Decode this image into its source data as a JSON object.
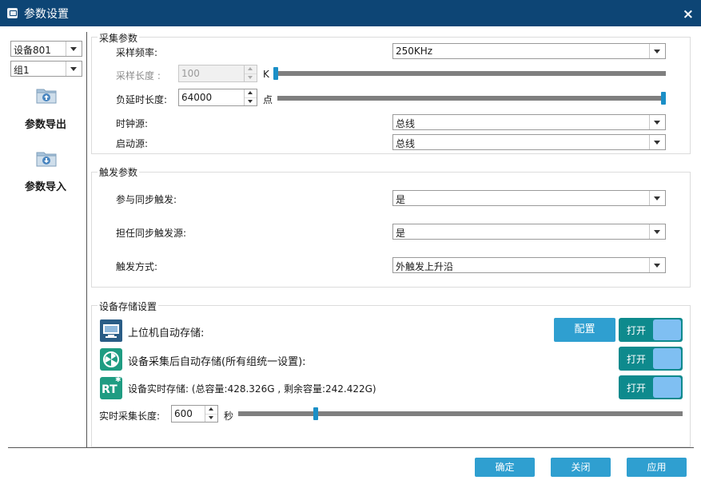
{
  "window": {
    "title": "参数设置",
    "close": "×"
  },
  "sidebar": {
    "device_select": "设备801",
    "group_select": "组1",
    "export_label": "参数导出",
    "import_label": "参数导入"
  },
  "acquisition": {
    "title": "采集参数",
    "sample_rate_label": "采样频率:",
    "sample_rate_value": "250KHz",
    "sample_length_label": "采样长度  :",
    "sample_length_value": "100",
    "sample_length_unit": "K",
    "sample_length_slider": 0.0,
    "neg_delay_label": "负延时长度:",
    "neg_delay_value": "64000",
    "neg_delay_unit": "点",
    "neg_delay_slider": 1.0,
    "clock_label": "时钟源:",
    "clock_value": "总线",
    "start_label": "启动源:",
    "start_value": "总线"
  },
  "trigger": {
    "title": "触发参数",
    "sync_label": "参与同步触发:",
    "sync_value": "是",
    "source_label": "担任同步触发源:",
    "source_value": "是",
    "mode_label": "触发方式:",
    "mode_value": "外触发上升沿"
  },
  "storage": {
    "title": "设备存储设置",
    "host_label": "上位机自动存储:",
    "config_button": "配置",
    "host_toggle": "打开",
    "after_label": "设备采集后自动存储(所有组统一设置):",
    "after_toggle": "打开",
    "realtime_label": "设备实时存储:  (总容量:428.326G , 剩余容量:242.422G)",
    "realtime_icon": "RT",
    "realtime_toggle": "打开",
    "length_label": "实时采集长度:",
    "length_value": "600",
    "length_unit": "秒",
    "length_slider": 0.17
  },
  "footer": {
    "ok": "确定",
    "close": "关闭",
    "apply": "应用"
  },
  "colors": {
    "titlebar": "#0d4575",
    "accent": "#2f9fd0",
    "toggle": "#0e8a8d",
    "slider_thumb": "#1a8fc7"
  }
}
